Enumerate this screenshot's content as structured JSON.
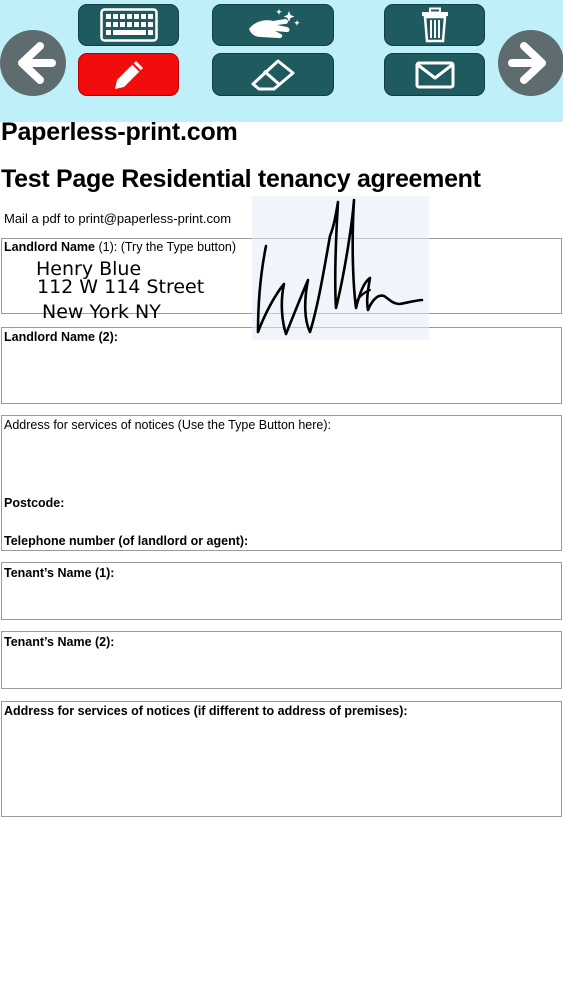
{
  "toolbar": {
    "buttons": [
      {
        "id": "keyboard",
        "icon": "keyboard-icon"
      },
      {
        "id": "clean",
        "icon": "clean-hand-icon"
      },
      {
        "id": "trash",
        "icon": "trash-icon"
      },
      {
        "id": "pen",
        "icon": "pencil-icon",
        "active_color": "#f20c0c"
      },
      {
        "id": "eraser",
        "icon": "eraser-icon"
      },
      {
        "id": "mail",
        "icon": "envelope-icon"
      }
    ],
    "prev_icon": "arrow-left-icon",
    "next_icon": "arrow-right-icon",
    "bg_color": "#bff0fa",
    "button_color": "#1f5a5e"
  },
  "document": {
    "site_name": "Paperless-print.com",
    "title": "Test Page Residential tenancy agreement",
    "mail_note": "Mail a pdf to print@paperless-print.com",
    "landlord1_label_bold": "Landlord Name",
    "landlord1_label_rest": " (1): (Try the Type button)",
    "landlord1_lines": [
      "Henry Blue",
      "112 W 114 Street",
      "New York NY"
    ],
    "landlord2_label": "Landlord Name (2):",
    "address_label": "Address for services of notices (Use the Type Button here):",
    "postcode_label": "Postcode:",
    "telephone_label": "Telephone number (of landlord or agent):",
    "tenant1_label": "Tenant’s Name (1):",
    "tenant2_label": "Tenant’s Name (2):",
    "tenant_address_label": "Address for services of notices (if different to address of premises):"
  }
}
